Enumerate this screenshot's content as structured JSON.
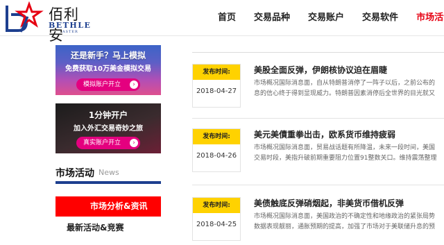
{
  "brand": {
    "name_cn": "佰利安",
    "name_en": "BETHLE",
    "sub": "ASTER",
    "colors": {
      "blue": "#1d3f8f",
      "red": "#e60012"
    }
  },
  "nav": {
    "items": [
      {
        "label": "首页",
        "active": false
      },
      {
        "label": "交易品种",
        "active": false
      },
      {
        "label": "交易账户",
        "active": false
      },
      {
        "label": "交易软件",
        "active": false
      },
      {
        "label": "市场活动",
        "active": true
      }
    ]
  },
  "sidebar": {
    "banner1": {
      "line1": "还是新手？马上模拟",
      "line2": "免费获取10万美金模拟交易",
      "button": "模拟账户开立"
    },
    "banner2": {
      "line1": "1分钟开户",
      "line2": "加入外汇交易奇妙之旅",
      "button": "真实账户开立"
    },
    "section": {
      "title": "市场活动",
      "subtitle": "News"
    },
    "menu": [
      {
        "label": "市场分析&资讯",
        "active": true
      },
      {
        "label": "最新活动&竞赛",
        "active": false
      }
    ]
  },
  "news": [
    {
      "tag": "发布时间:",
      "date": "2018-04-27",
      "title": "美股全面反弹，伊朗核协议迫在眉睫",
      "summary_line1": "市场概况国际消息面，自从特朗普消停了一阵子以后，之前公布的",
      "summary_line2": "息的信心终于得到显现威力。特朗普因素消停后全世界的目光就又"
    },
    {
      "tag": "发布时间:",
      "date": "2018-04-26",
      "title": "美元美債重拳出击，欧系货币维持疲弱",
      "summary_line1": "市场概况国际消息面，贸易战话题有所降温，未来一段时间，美国",
      "summary_line2": "交易时段，美指升破前期重要阻力位置91整数关口。维持震荡整理"
    },
    {
      "tag": "发布时间:",
      "date": "2018-04-25",
      "title": "美债触底反弹硝烟起，非美货币借机反弹",
      "summary_line1": "市场概况国际消息面，美国政治的不确定性和地缘政治的紧张局势",
      "summary_line2": "数据表现靓丽，通胀预期的提高，加强了市场对于美联储升息的预"
    }
  ]
}
